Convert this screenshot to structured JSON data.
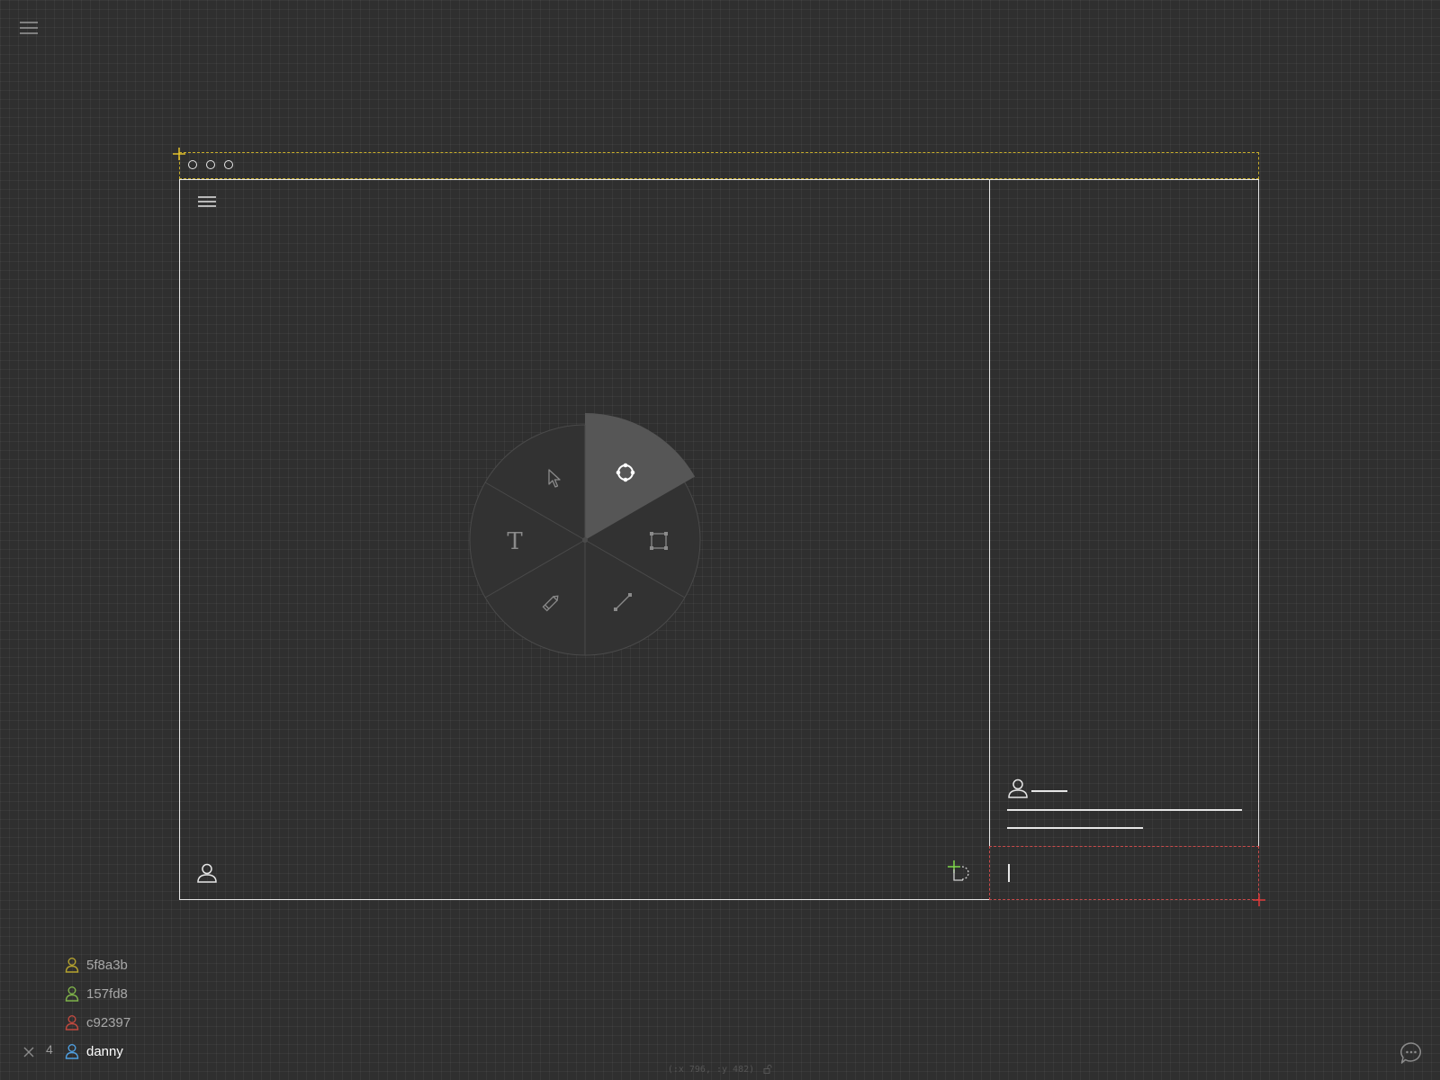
{
  "app": {
    "menu_icon": "hamburger-icon",
    "chat_icon": "chat-bubble-icon",
    "close_icon": "close-icon"
  },
  "wireframe": {
    "window_dots": [
      "circle",
      "circle",
      "circle"
    ],
    "menu_icon": "hamburger-icon",
    "user_icon": "user-icon",
    "text_cursor": "|"
  },
  "radial_menu": {
    "items": [
      {
        "name": "select",
        "icon": "pointer-icon",
        "active": false
      },
      {
        "name": "move",
        "icon": "move-handle-icon",
        "active": true
      },
      {
        "name": "rectangle",
        "icon": "rectangle-icon",
        "active": false
      },
      {
        "name": "line",
        "icon": "line-icon",
        "active": false
      },
      {
        "name": "pencil",
        "icon": "pencil-icon",
        "active": false
      },
      {
        "name": "text",
        "icon": "text-icon",
        "active": false
      }
    ],
    "text_glyph": "T"
  },
  "users": {
    "count": "4",
    "list": [
      {
        "name": "5f8a3b",
        "color": "#b5a32e",
        "current": false
      },
      {
        "name": "157fd8",
        "color": "#7fb34a",
        "current": false
      },
      {
        "name": "c92397",
        "color": "#c0493f",
        "current": false
      },
      {
        "name": "danny",
        "color": "#4f9fe0",
        "current": true
      }
    ]
  },
  "status": {
    "coordinates": "(:x 796, :y 482)",
    "unlock_icon": "unlock-icon"
  },
  "colors": {
    "background": "#2f2f2f",
    "outline": "#e6e6e6",
    "titlebar_dash": "#c7ad2a",
    "input_dash": "#c94a4a",
    "green_marker": "#7fd94a"
  }
}
